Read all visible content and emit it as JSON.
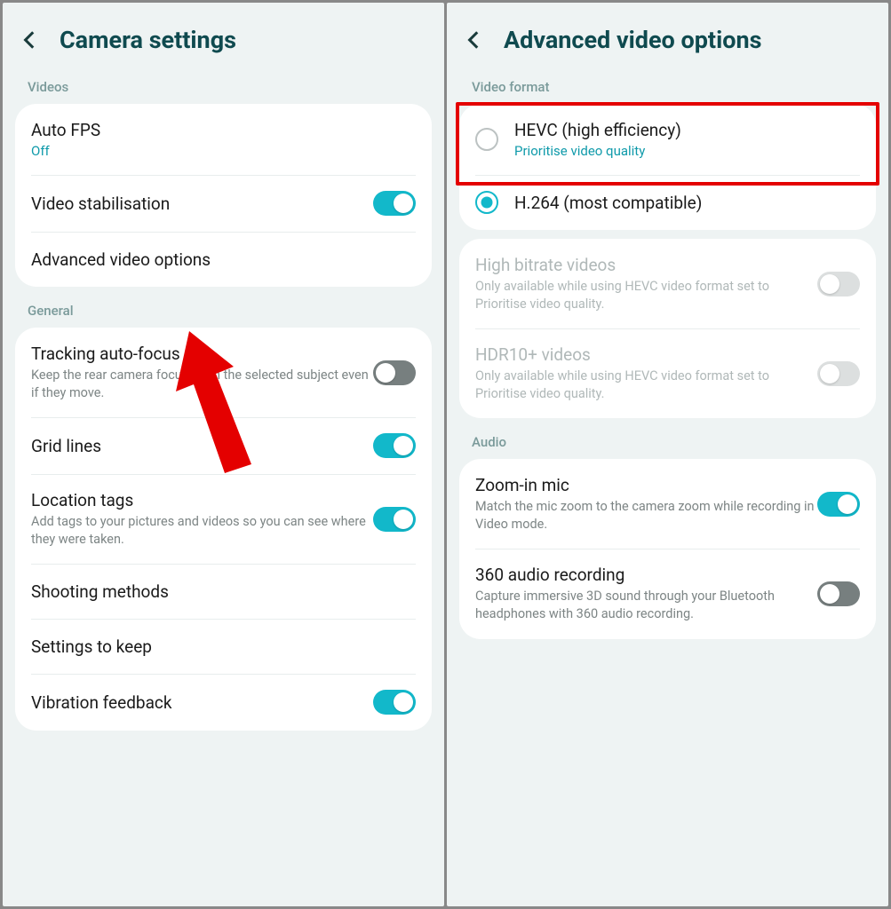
{
  "left": {
    "title": "Camera settings",
    "section_videos": "Videos",
    "auto_fps": {
      "title": "Auto FPS",
      "sub": "Off"
    },
    "video_stabilisation": {
      "title": "Video stabilisation",
      "on": true
    },
    "advanced_video_options": {
      "title": "Advanced video options"
    },
    "section_general": "General",
    "tracking_autofocus": {
      "title": "Tracking auto-focus",
      "desc": "Keep the rear camera focused on the selected subject even if they move.",
      "on": false
    },
    "grid_lines": {
      "title": "Grid lines",
      "on": true
    },
    "location_tags": {
      "title": "Location tags",
      "desc": "Add tags to your pictures and videos so you can see where they were taken.",
      "on": true
    },
    "shooting_methods": {
      "title": "Shooting methods"
    },
    "settings_to_keep": {
      "title": "Settings to keep"
    },
    "vibration_feedback": {
      "title": "Vibration feedback",
      "on": true
    }
  },
  "right": {
    "title": "Advanced video options",
    "section_video_format": "Video format",
    "hevc": {
      "title": "HEVC (high efficiency)",
      "sub": "Prioritise video quality",
      "selected": false
    },
    "h264": {
      "title": "H.264 (most compatible)",
      "selected": true
    },
    "high_bitrate": {
      "title": "High bitrate videos",
      "desc": "Only available while using HEVC video format set to Prioritise video quality.",
      "disabled": true
    },
    "hdr10": {
      "title": "HDR10+ videos",
      "desc": "Only available while using HEVC video format set to Prioritise video quality.",
      "disabled": true
    },
    "section_audio": "Audio",
    "zoom_in_mic": {
      "title": "Zoom-in mic",
      "desc": "Match the mic zoom to the camera zoom while recording in Video mode.",
      "on": true
    },
    "audio_360": {
      "title": "360 audio recording",
      "desc": "Capture immersive 3D sound through your Bluetooth headphones with 360 audio recording.",
      "on": false
    }
  },
  "annotations": {
    "highlight_target": "hevc-option",
    "arrow_target": "advanced-video-options"
  }
}
